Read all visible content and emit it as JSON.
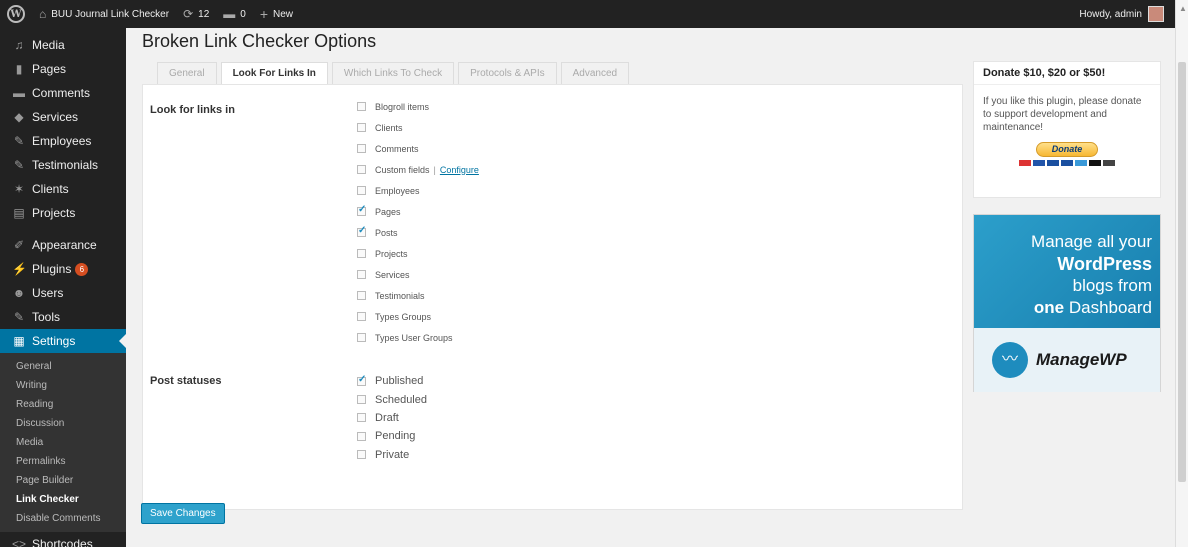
{
  "adminbar": {
    "site_name": "BUU Journal Link Checker",
    "updates_count": "12",
    "comments_count": "0",
    "new_label": "New",
    "howdy": "Howdy, admin"
  },
  "sidebar": {
    "items": [
      {
        "icon": "media-icon",
        "label": "Media"
      },
      {
        "icon": "pages-icon",
        "label": "Pages"
      },
      {
        "icon": "comments-icon",
        "label": "Comments"
      },
      {
        "icon": "services-icon",
        "label": "Services"
      },
      {
        "icon": "pin-icon",
        "label": "Employees"
      },
      {
        "icon": "pin-icon",
        "label": "Testimonials"
      },
      {
        "icon": "star-icon",
        "label": "Clients"
      },
      {
        "icon": "document-icon",
        "label": "Projects"
      }
    ],
    "items2": [
      {
        "icon": "brush-icon",
        "label": "Appearance"
      },
      {
        "icon": "plug-icon",
        "label": "Plugins",
        "badge": "6"
      },
      {
        "icon": "users-icon",
        "label": "Users"
      },
      {
        "icon": "wrench-icon",
        "label": "Tools"
      },
      {
        "icon": "settings-icon",
        "label": "Settings"
      }
    ],
    "submenu": [
      "General",
      "Writing",
      "Reading",
      "Discussion",
      "Media",
      "Permalinks",
      "Page Builder",
      "Link Checker",
      "Disable Comments"
    ],
    "bottom_item": {
      "icon": "code-icon",
      "label": "Shortcodes"
    }
  },
  "page": {
    "title": "Broken Link Checker Options",
    "tabs": [
      "General",
      "Look For Links In",
      "Which Links To Check",
      "Protocols & APIs",
      "Advanced"
    ],
    "active_tab": "Look For Links In"
  },
  "look_for": {
    "label": "Look for links in",
    "items": [
      {
        "label": "Blogroll items",
        "checked": false
      },
      {
        "label": "Clients",
        "checked": false
      },
      {
        "label": "Comments",
        "checked": false
      },
      {
        "label": "Custom fields",
        "checked": false,
        "separator": "|",
        "link": "Configure"
      },
      {
        "label": "Employees",
        "checked": false
      },
      {
        "label": "Pages",
        "checked": true
      },
      {
        "label": "Posts",
        "checked": true
      },
      {
        "label": "Projects",
        "checked": false
      },
      {
        "label": "Services",
        "checked": false
      },
      {
        "label": "Testimonials",
        "checked": false
      },
      {
        "label": "Types Groups",
        "checked": false
      },
      {
        "label": "Types User Groups",
        "checked": false
      }
    ]
  },
  "post_statuses": {
    "label": "Post statuses",
    "items": [
      {
        "label": "Published",
        "checked": true
      },
      {
        "label": "Scheduled",
        "checked": false
      },
      {
        "label": "Draft",
        "checked": false
      },
      {
        "label": "Pending",
        "checked": false
      },
      {
        "label": "Private",
        "checked": false
      }
    ]
  },
  "save_label": "Save Changes",
  "donate": {
    "title": "Donate $10, $20 or $50!",
    "text": "If you like this plugin, please donate to support development and maintenance!",
    "button": "Donate",
    "card_colors": [
      "#d33",
      "#2255aa",
      "#1a4fa0",
      "#1a4fa0",
      "#3a9ad9",
      "#111",
      "#444"
    ]
  },
  "ad": {
    "line1": "Manage all your",
    "line2": "WordPress",
    "line3": "blogs from",
    "line4_bold": "one",
    "line4_rest": " Dashboard",
    "brand": "ManageWP"
  },
  "colors": {
    "accent": "#0074a2",
    "button": "#2ea2cc",
    "sidebar_bg": "#222222"
  }
}
